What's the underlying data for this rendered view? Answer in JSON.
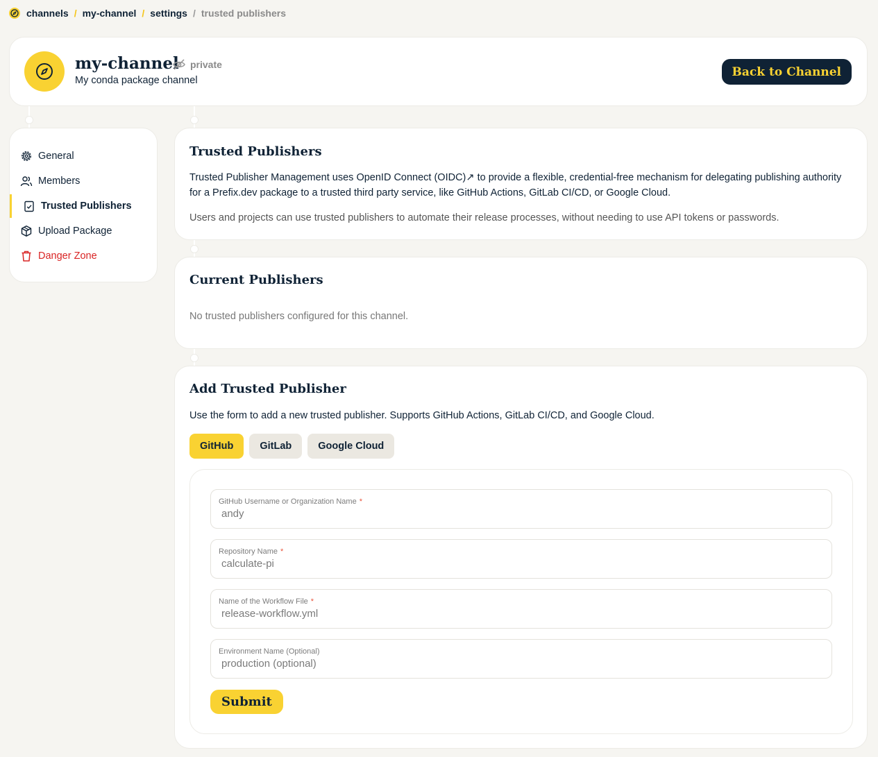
{
  "breadcrumb": {
    "items": [
      "channels",
      "my-channel",
      "settings"
    ],
    "current": "trusted publishers",
    "separator": "/"
  },
  "channel": {
    "name": "my-channel",
    "visibility": "private",
    "description": "My conda package channel",
    "back_label": "Back to Channel"
  },
  "sidebar": {
    "items": [
      {
        "label": "General",
        "icon": "gear-icon"
      },
      {
        "label": "Members",
        "icon": "users-icon"
      },
      {
        "label": "Trusted Publishers",
        "icon": "clipboard-check-icon"
      },
      {
        "label": "Upload Package",
        "icon": "package-icon"
      },
      {
        "label": "Danger Zone",
        "icon": "trash-icon"
      }
    ]
  },
  "trusted": {
    "title": "Trusted Publishers",
    "p1": "Trusted Publisher Management uses OpenID Connect (OIDC)↗ to provide a flexible, credential-free mechanism for delegating publishing authority for a Prefix.dev package to a trusted third party service, like GitHub Actions, GitLab CI/CD, or Google Cloud.",
    "p2": "Users and projects can use trusted publishers to automate their release processes, without needing to use API tokens or passwords."
  },
  "current": {
    "title": "Current Publishers",
    "empty": "No trusted publishers configured for this channel."
  },
  "add": {
    "title": "Add Trusted Publisher",
    "description": "Use the form to add a new trusted publisher. Supports GitHub Actions, GitLab CI/CD, and Google Cloud.",
    "tabs": [
      "GitHub",
      "GitLab",
      "Google Cloud"
    ],
    "active_tab": "GitHub",
    "fields": [
      {
        "label": "GitHub Username or Organization Name",
        "required": "*",
        "placeholder": "andy"
      },
      {
        "label": "Repository Name",
        "required": "*",
        "placeholder": "calculate-pi"
      },
      {
        "label": "Name of the Workflow File",
        "required": "*",
        "placeholder": "release-workflow.yml"
      },
      {
        "label": "Environment Name (Optional)",
        "required": "",
        "placeholder": "production (optional)"
      }
    ],
    "submit_label": "Submit"
  },
  "colors": {
    "accent": "#f9d232",
    "navy": "#0f2235",
    "danger": "#d92424",
    "background": "#f6f5f1"
  }
}
